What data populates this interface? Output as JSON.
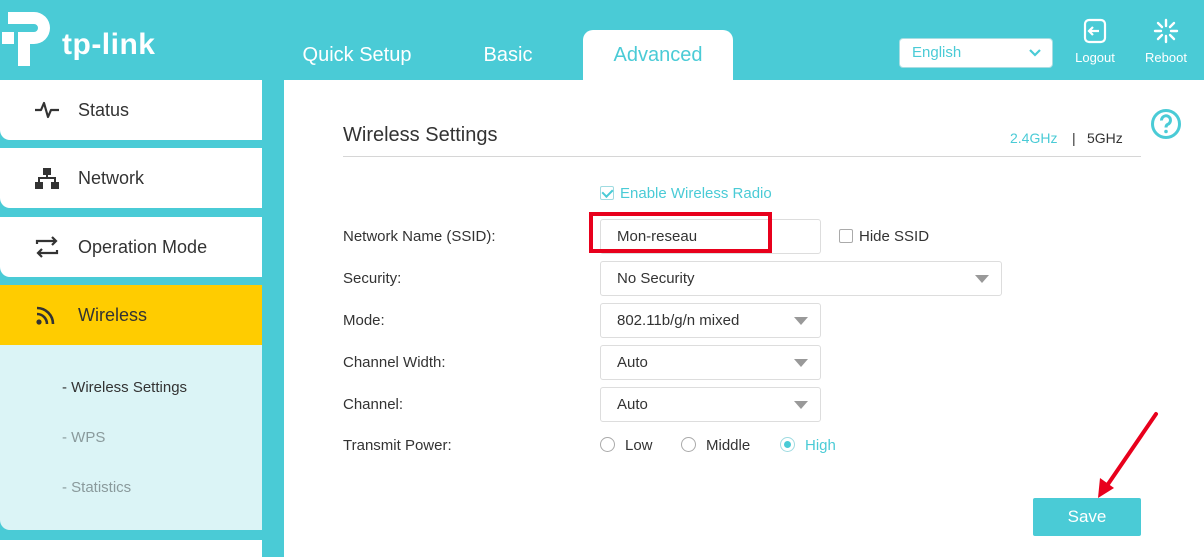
{
  "brand": {
    "logo_text": "tp-link",
    "accent_color": "#4acbd6",
    "highlight_color": "#ffcc00"
  },
  "header": {
    "tabs": [
      {
        "label": "Quick Setup"
      },
      {
        "label": "Basic"
      },
      {
        "label": "Advanced",
        "active": true
      }
    ],
    "language": {
      "selected": "English"
    },
    "logout_label": "Logout",
    "reboot_label": "Reboot"
  },
  "sidebar": {
    "items": [
      {
        "label": "Status",
        "icon": "pulse-icon"
      },
      {
        "label": "Network",
        "icon": "network-icon"
      },
      {
        "label": "Operation Mode",
        "icon": "operation-mode-icon"
      },
      {
        "label": "Wireless",
        "icon": "wireless-icon",
        "active": true
      }
    ],
    "sub_items": [
      {
        "label": "-  Wireless Settings",
        "active": true
      },
      {
        "label": "-  WPS"
      },
      {
        "label": "-  Statistics"
      }
    ]
  },
  "main": {
    "title": "Wireless Settings",
    "band_24": "2.4GHz",
    "band_sep": "|",
    "band_5": "5GHz",
    "enable_label": "Enable Wireless Radio",
    "enable_checked": true,
    "fields": {
      "ssid_label": "Network Name (SSID):",
      "ssid_value": "Mon-reseau",
      "hide_ssid_label": "Hide SSID",
      "hide_ssid_checked": false,
      "security_label": "Security:",
      "security_value": "No Security",
      "mode_label": "Mode:",
      "mode_value": "802.11b/g/n mixed",
      "width_label": "Channel Width:",
      "width_value": "Auto",
      "channel_label": "Channel:",
      "channel_value": "Auto",
      "power_label": "Transmit Power:",
      "power_options": [
        "Low",
        "Middle",
        "High"
      ],
      "power_selected": "High"
    },
    "save_label": "Save"
  }
}
